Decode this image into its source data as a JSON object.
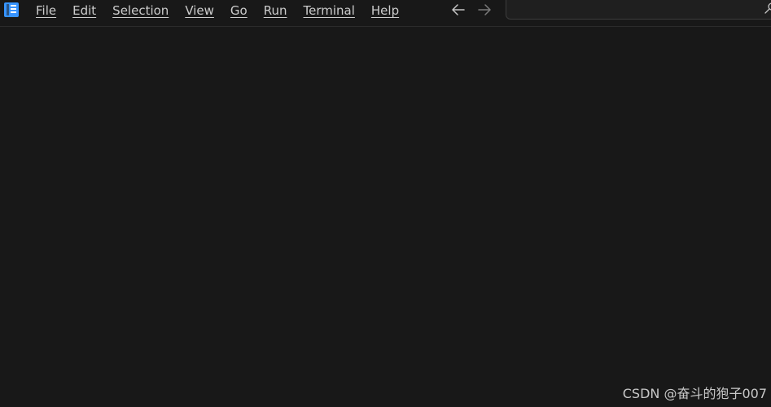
{
  "app": {
    "logo_icon": "vscode-logo-icon",
    "accent_color": "#3794ff"
  },
  "menubar": {
    "items": [
      {
        "label": "File"
      },
      {
        "label": "Edit"
      },
      {
        "label": "Selection"
      },
      {
        "label": "View"
      },
      {
        "label": "Go"
      },
      {
        "label": "Run"
      },
      {
        "label": "Terminal"
      },
      {
        "label": "Help"
      }
    ]
  },
  "navigation": {
    "back_icon": "arrow-left-icon",
    "forward_icon": "arrow-right-icon"
  },
  "command_center": {
    "value": "",
    "icon": "search-icon"
  },
  "watermark": {
    "text": "CSDN @奋斗的狍子007"
  },
  "colors": {
    "background": "#181818",
    "menu_text": "#cccccc",
    "border": "#2b2b2b"
  }
}
